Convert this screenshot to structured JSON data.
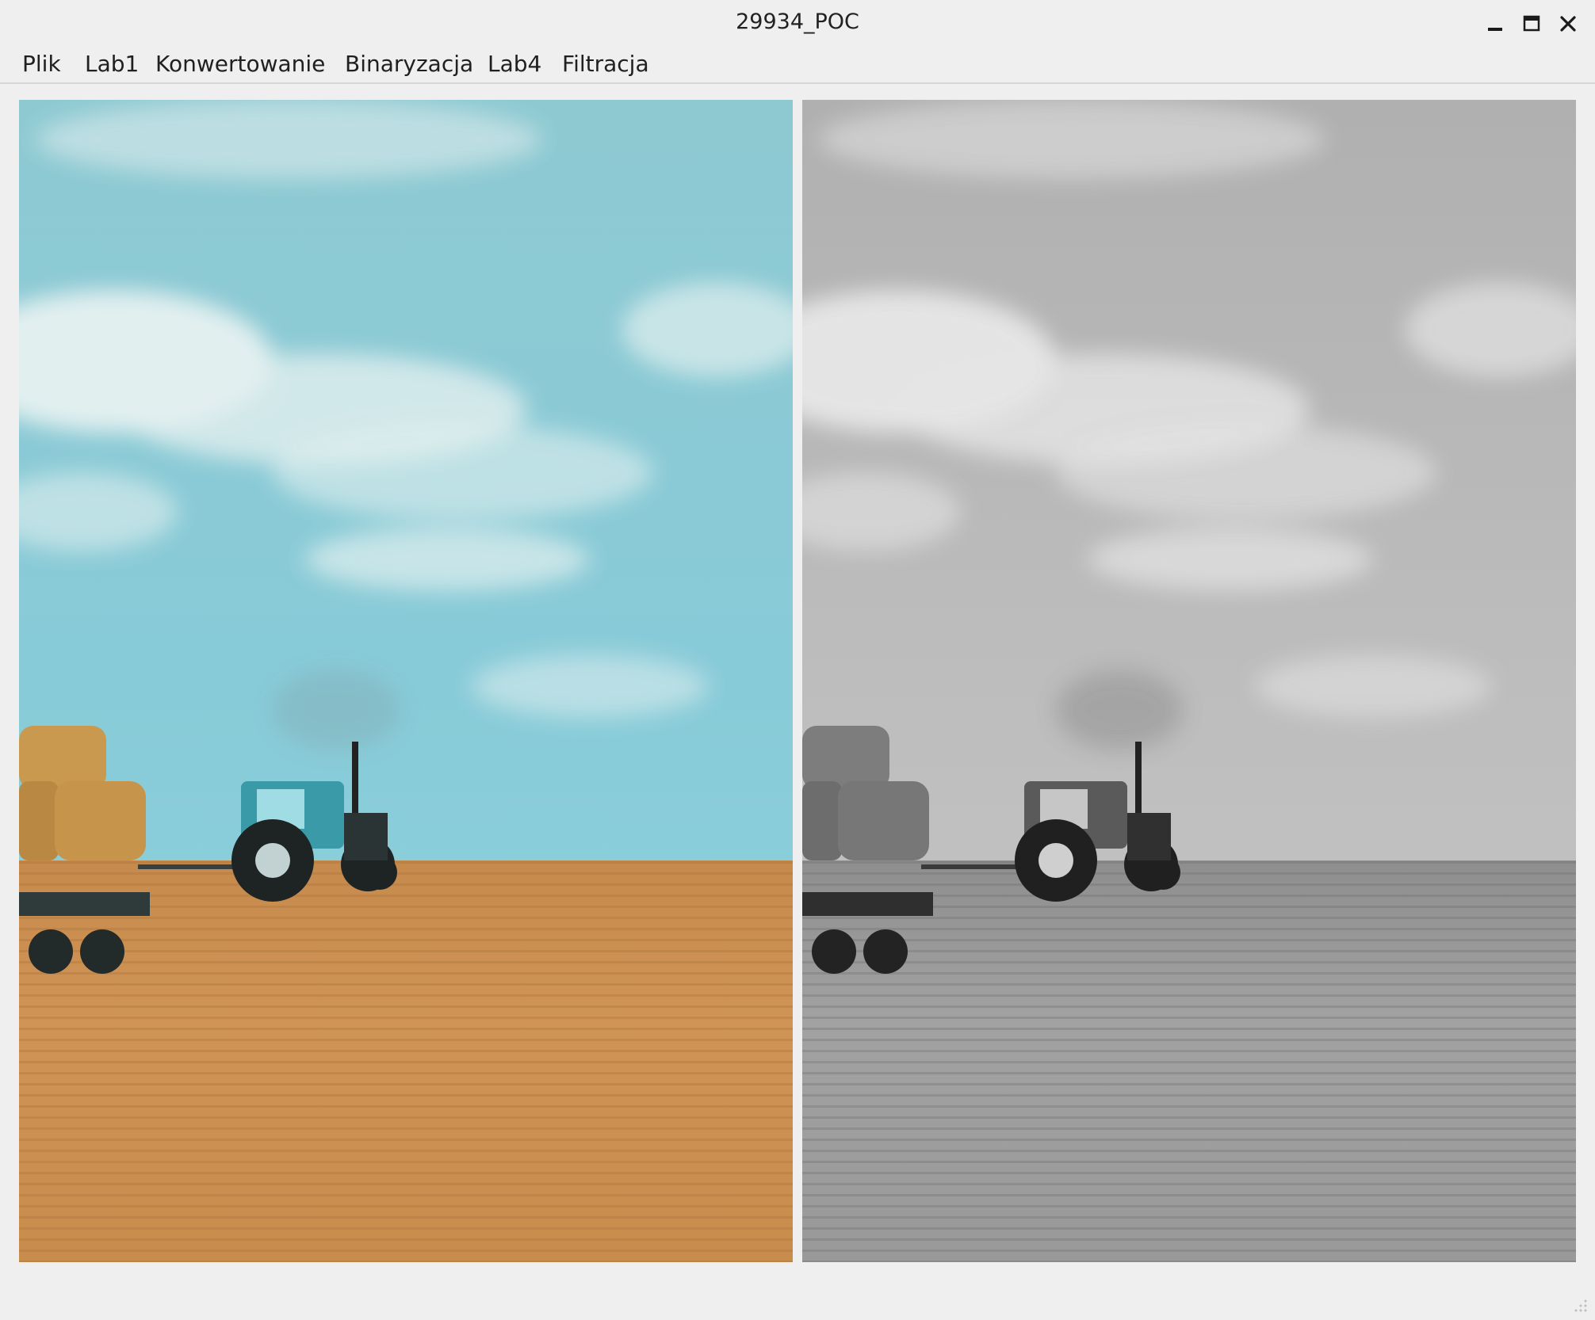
{
  "window": {
    "title": "29934_POC",
    "controls": [
      "minimize-icon",
      "maximize-icon",
      "close-icon"
    ]
  },
  "menu": {
    "items": [
      {
        "label": "Plik"
      },
      {
        "label": "Lab1"
      },
      {
        "label": "Konwertowanie"
      },
      {
        "label": "Binaryzacja"
      },
      {
        "label": "Lab4"
      },
      {
        "label": "Filtracja"
      }
    ]
  },
  "images": {
    "original": {
      "description": "color photo",
      "sky_color": "#7cc9d6",
      "field_color": "#c8894a"
    },
    "converted": {
      "description": "grayscale photo",
      "sky_color": "#b9b9b9",
      "field_color": "#9a9a9a"
    }
  },
  "colors": {
    "window_bg": "#efefef",
    "text": "#1b1b1b"
  }
}
